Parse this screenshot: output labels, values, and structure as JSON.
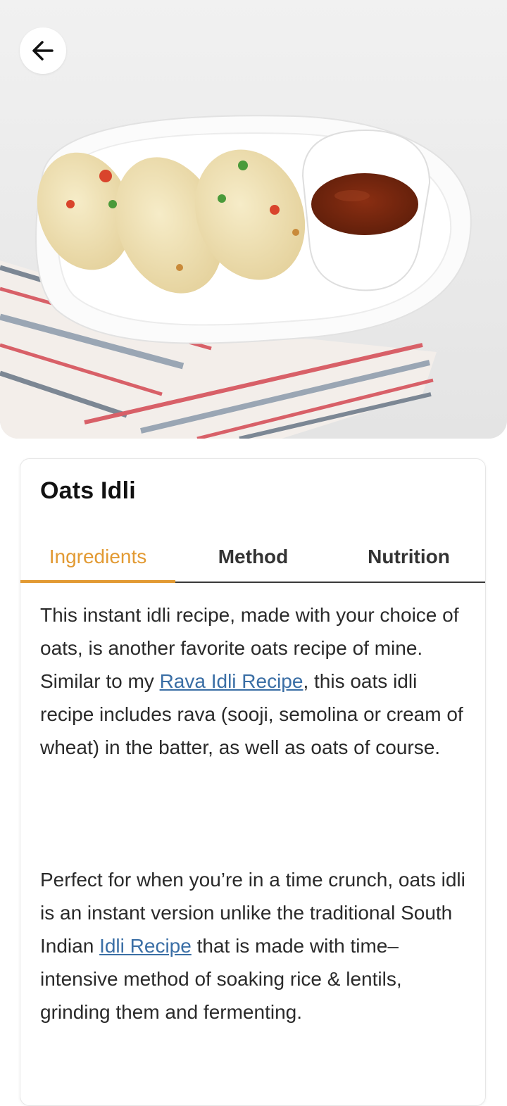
{
  "header": {
    "back_icon": "arrow-left-icon",
    "hero_image": "oats-idli-photo"
  },
  "recipe": {
    "title": "Oats Idli"
  },
  "tabs": [
    {
      "label": "Ingredients",
      "active": true
    },
    {
      "label": "Method",
      "active": false
    },
    {
      "label": "Nutrition",
      "active": false
    }
  ],
  "content": {
    "p1_before": "This instant idli recipe, made with your choice of oats, is another favorite oats recipe of mine. Similar to my ",
    "p1_link": "Rava Idli Recipe",
    "p1_after": ", this oats idli recipe includes rava (sooji, semolina or cream of wheat) in the batter, as well as oats of course.",
    "p2_before": "Perfect for when you’re in a time crunch, oats idli is an instant version unlike the traditional South Indian ",
    "p2_link": "Idli Recipe",
    "p2_after": " that is made with time–intensive method of soaking rice & lentils, grinding them and fermenting."
  },
  "colors": {
    "accent": "#e29a33",
    "link": "#3a6ea5",
    "text": "#2a2a2a"
  }
}
